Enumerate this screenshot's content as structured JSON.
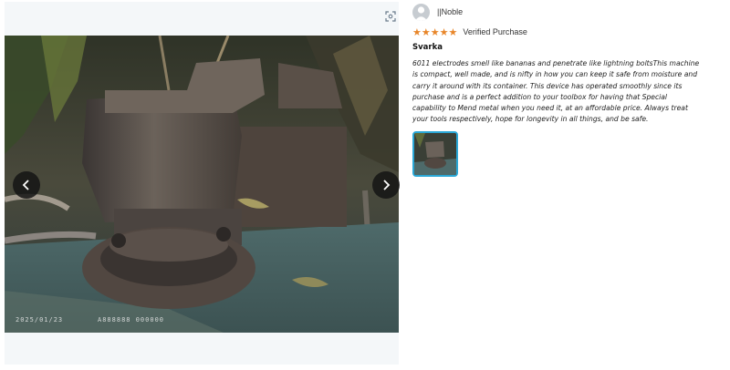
{
  "gallery": {
    "expand_icon": "expand-scan-icon",
    "photo_stamp_date": "2025/01/23",
    "photo_stamp_code": "A888888 000000",
    "prev_icon": "chevron-left-icon",
    "next_icon": "chevron-right-icon"
  },
  "review": {
    "reviewer_name": "||Noble",
    "avatar_icon": "user-avatar-icon",
    "rating": 5,
    "stars": [
      "★",
      "★",
      "★",
      "★",
      "★"
    ],
    "verified_label": "Verified Purchase",
    "title": "Svarka",
    "body": "6011 electrodes smell like bananas and penetrate like lightning boltsThis machine is compact, well made, and is nifty in how you can keep it safe from moisture and carry it around with its container. This device has operated smoothly since its purchase and is a perfect addition to your toolbox for having that Special capability to Mend metal when you need it, at an affordable price. Always treat your tools respectively, hope for longevity in all things, and be safe."
  },
  "colors": {
    "star": "#e8862a",
    "thumb_border": "#2aa7d6",
    "nav_button": "#141414"
  }
}
